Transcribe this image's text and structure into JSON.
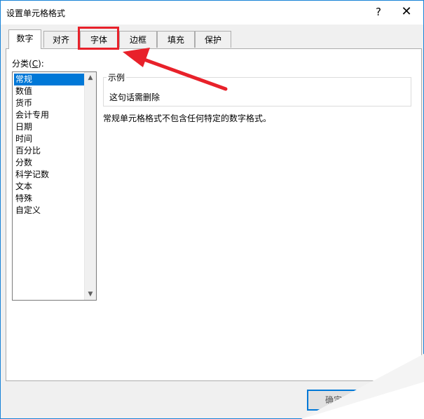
{
  "window": {
    "title": "设置单元格格式"
  },
  "titlebar": {
    "help_label": "?",
    "close_label": "✕"
  },
  "tabs": [
    {
      "label": "数字",
      "active": true
    },
    {
      "label": "对齐"
    },
    {
      "label": "字体",
      "highlighted": true
    },
    {
      "label": "边框"
    },
    {
      "label": "填充"
    },
    {
      "label": "保护"
    }
  ],
  "category": {
    "label_prefix": "分类(",
    "label_key": "C",
    "label_suffix": "):",
    "items": [
      "常规",
      "数值",
      "货币",
      "会计专用",
      "日期",
      "时间",
      "百分比",
      "分数",
      "科学记数",
      "文本",
      "特殊",
      "自定义"
    ],
    "selected_index": 0
  },
  "sample": {
    "legend": "示例",
    "text": "这句话需删除"
  },
  "description": "常规单元格格式不包含任何特定的数字格式。",
  "buttons": {
    "ok_label": "确定"
  },
  "colors": {
    "accent": "#0078d7",
    "highlight_box": "#e8212a",
    "border": "#1883d7"
  }
}
